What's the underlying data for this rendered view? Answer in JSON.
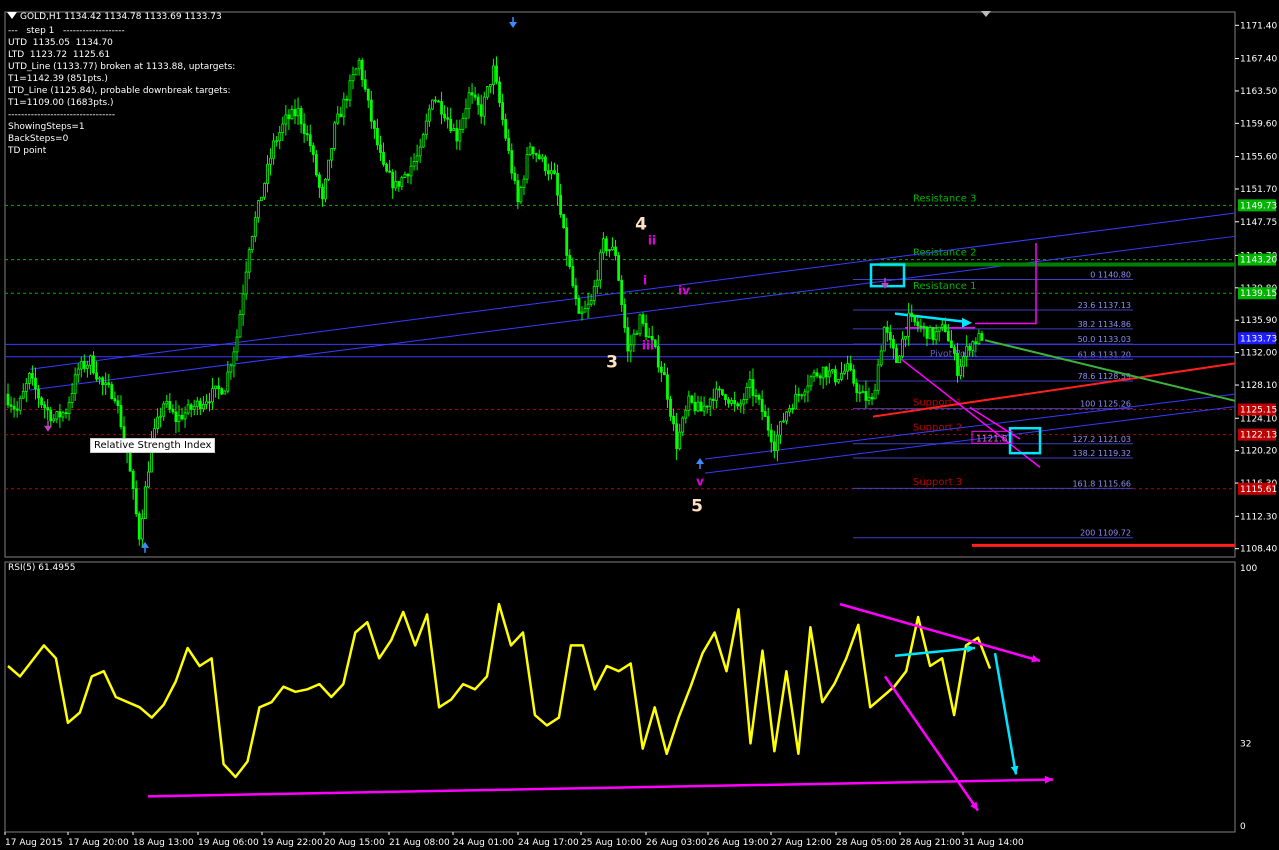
{
  "chart_header": {
    "title": "GOLD,H1  1134.42 1134.78 1133.69 1133.73",
    "info_lines": [
      "---   step 1   -------------------",
      "UTD  1135.05  1134.70",
      "LTD  1123.72  1125.61",
      "UTD_Line (1133.77) broken at 1133.88, uptargets:",
      "T1=1142.39 (851pts.)",
      "LTD_Line (1125.84), probable downbreak targets:",
      "T1=1109.00 (1683pts.)",
      "---------------------------------",
      "ShowingSteps=1",
      "BackSteps=0",
      "TD point"
    ]
  },
  "chart_data": [
    {
      "type": "candlestick",
      "title": "GOLD,H1",
      "ylim": [
        1107.4,
        1173.0
      ],
      "price_ticks": [
        "1171.40",
        "1167.40",
        "1163.50",
        "1159.60",
        "1155.60",
        "1151.70",
        "1147.75",
        "1143.70",
        "1139.80",
        "1135.90",
        "1132.00",
        "1128.10",
        "1124.10",
        "1120.20",
        "1116.30",
        "1112.30",
        "1108.40"
      ],
      "x_tick_labels": [
        "17 Aug 2015",
        "17 Aug 20:00",
        "18 Aug 13:00",
        "19 Aug 06:00",
        "19 Aug 22:00",
        "20 Aug 15:00",
        "21 Aug 08:00",
        "24 Aug 01:00",
        "24 Aug 17:00",
        "25 Aug 10:00",
        "26 Aug 03:00",
        "26 Aug 19:00",
        "27 Aug 12:00",
        "28 Aug 05:00",
        "28 Aug 21:00",
        "31 Aug 14:00"
      ],
      "price_path": [
        1127,
        1125,
        1129,
        1126,
        1124,
        1125,
        1130,
        1131,
        1128,
        1127,
        1120,
        1110,
        1121,
        1126,
        1124,
        1125,
        1126,
        1127,
        1128,
        1134,
        1145,
        1151,
        1157,
        1160,
        1161,
        1157,
        1150,
        1159,
        1163,
        1167,
        1160,
        1154,
        1152,
        1154,
        1156,
        1163,
        1161,
        1158,
        1163,
        1161,
        1166,
        1158,
        1150,
        1157,
        1155,
        1153,
        1144,
        1136,
        1138,
        1145,
        1144,
        1132,
        1136,
        1133,
        1129,
        1121,
        1126,
        1125,
        1127,
        1127,
        1125,
        1128,
        1125,
        1121,
        1125,
        1127,
        1129,
        1130,
        1129,
        1130,
        1127,
        1126,
        1135,
        1131,
        1136,
        1135,
        1134,
        1135,
        1130,
        1133,
        1134
      ],
      "current_price": "1133.73",
      "right_tags": [
        {
          "label": "1149.73",
          "price": 1149.73,
          "color": "#00b400"
        },
        {
          "label": "1143.20",
          "price": 1143.2,
          "color": "#00b400"
        },
        {
          "label": "1139.15",
          "price": 1139.15,
          "color": "#00b400"
        },
        {
          "label": "1133.73",
          "price": 1133.73,
          "color": "#1d1dff"
        },
        {
          "label": "1125.15",
          "price": 1125.15,
          "color": "#c00000"
        },
        {
          "label": "1122.13",
          "price": 1122.13,
          "color": "#c00000"
        },
        {
          "label": "1115.61",
          "price": 1115.61,
          "color": "#c00000"
        }
      ],
      "pivot_lines": [
        {
          "price": 1149.73,
          "color": "#00b400",
          "label": "Resistance 3"
        },
        {
          "price": 1143.2,
          "color": "#00b400",
          "label": "Resistance 2"
        },
        {
          "price": 1139.15,
          "color": "#00b400",
          "label": "Resistance 1"
        },
        {
          "price": 1125.15,
          "color": "#c00000",
          "label": "Support 1"
        },
        {
          "price": 1122.13,
          "color": "#c00000",
          "label": "Support 2"
        },
        {
          "price": 1115.61,
          "color": "#c00000",
          "label": "Support 3"
        }
      ],
      "fibonacci_levels": [
        {
          "label": "0 1140.80",
          "price": 1140.8
        },
        {
          "label": "23.6 1137.13",
          "price": 1137.13
        },
        {
          "label": "38.2 1134.86",
          "price": 1134.86
        },
        {
          "label": "50.0 1133.03",
          "price": 1133.03
        },
        {
          "label": "61.8 1131.20",
          "price": 1131.2
        },
        {
          "label": "78.6 1128.59",
          "price": 1128.59
        },
        {
          "label": "100 1125.26",
          "price": 1125.26
        },
        {
          "label": "127.2 1121.03",
          "price": 1121.03
        },
        {
          "label": "138.2 1119.32",
          "price": 1119.32
        },
        {
          "label": "161.8 1115.66",
          "price": 1115.66
        },
        {
          "label": "200 1109.72",
          "price": 1109.72
        }
      ],
      "pivot_point_label": "Pivot Point",
      "target_box_label": "1121.8",
      "wave_labels": [
        {
          "text": "3",
          "price": 1130.2,
          "color": "#ffe0c0"
        },
        {
          "text": "4",
          "price": 1146.8,
          "color": "#ffe0c0"
        },
        {
          "text": "5",
          "price": 1112.9,
          "color": "#ffe0c0"
        },
        {
          "text": "i",
          "price": 1140.2,
          "color": "#e000e0"
        },
        {
          "text": "ii",
          "price": 1145.0,
          "color": "#e000e0"
        },
        {
          "text": "iii",
          "price": 1132.4,
          "color": "#e000e0"
        },
        {
          "text": "iv",
          "price": 1139.0,
          "color": "#e000e0"
        },
        {
          "text": "v",
          "price": 1116.0,
          "color": "#e000e0"
        }
      ],
      "colors": {
        "candles": "#00ff00",
        "grid": "#1a1a1a",
        "fib": "#4040c0",
        "axis_text": "#ffffff"
      }
    },
    {
      "type": "line",
      "title": "RSI(5) 61.4955",
      "series": [
        {
          "name": "RSI(5)",
          "values": [
            62,
            58,
            64,
            70,
            65,
            40,
            44,
            58,
            60,
            50,
            48,
            46,
            42,
            47,
            56,
            69,
            62,
            65,
            24,
            19,
            25,
            46,
            48,
            54,
            52,
            53,
            55,
            50,
            55,
            75,
            79,
            65,
            72,
            83,
            70,
            82,
            46,
            49,
            55,
            53,
            58,
            86,
            70,
            75,
            43,
            39,
            42,
            70,
            70,
            53,
            62,
            60,
            63,
            30,
            46,
            28,
            42,
            54,
            67,
            75,
            60,
            84,
            32,
            68,
            29,
            60,
            28,
            77,
            48,
            55,
            65,
            78,
            46,
            50,
            54,
            60,
            81,
            62,
            65,
            43,
            70,
            73,
            61
          ]
        }
      ],
      "ylim": [
        0,
        100
      ],
      "y_ticks": [
        "100",
        "32",
        "0"
      ],
      "colors": {
        "line": "#ffff00",
        "trend": "#ff00ff",
        "arrow": "#00e5ff"
      }
    }
  ],
  "tooltip": {
    "label": "Relative Strength Index"
  }
}
